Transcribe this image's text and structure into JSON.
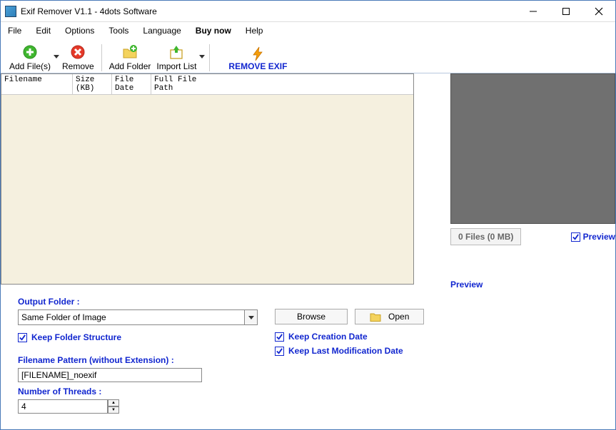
{
  "title": "Exif Remover V1.1 - 4dots Software",
  "menu": {
    "file": "File",
    "edit": "Edit",
    "options": "Options",
    "tools": "Tools",
    "language": "Language",
    "buynow": "Buy now",
    "help": "Help"
  },
  "toolbar": {
    "add_files": "Add File(s)",
    "remove": "Remove",
    "add_folder": "Add Folder",
    "import_list": "Import List",
    "remove_exif": "REMOVE EXIF"
  },
  "grid": {
    "col_filename": "Filename",
    "col_size": "Size\n(KB)",
    "col_filedate": "File\nDate",
    "col_fullpath": "Full File\nPath"
  },
  "right": {
    "files_count": "0 Files (0 MB)",
    "preview_check": "Preview",
    "preview_label": "Preview"
  },
  "bottom": {
    "output_folder_label": "Output Folder :",
    "output_folder_value": "Same Folder of Image",
    "browse": "Browse",
    "open": "Open",
    "keep_folder_structure": "Keep Folder Structure",
    "keep_creation_date": "Keep Creation Date",
    "keep_last_mod_date": "Keep Last Modification Date",
    "filename_pattern_label": "Filename Pattern (without Extension) :",
    "filename_pattern_value": "[FILENAME]_noexif",
    "num_threads_label": "Number of Threads :",
    "num_threads_value": "4"
  }
}
